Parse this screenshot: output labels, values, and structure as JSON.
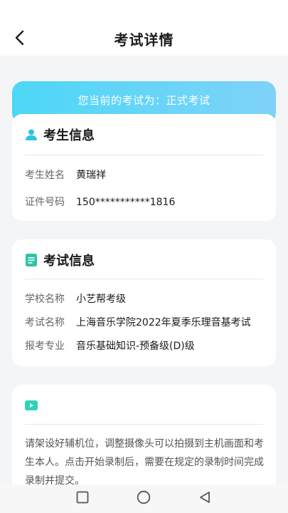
{
  "header": {
    "title": "考试详情",
    "back_icon": "chevron-left-icon"
  },
  "banner": {
    "text": "您当前的考试为：正式考试"
  },
  "candidate": {
    "title": "考生信息",
    "icon": "user-icon",
    "icon_color": "#2fc3e2",
    "rows": [
      {
        "label": "考生姓名",
        "value": "黄瑞祥"
      },
      {
        "label": "证件号码",
        "value": "150***********1816"
      }
    ]
  },
  "exam": {
    "title": "考试信息",
    "icon": "document-icon",
    "icon_color": "#2fc3a6",
    "rows": [
      {
        "label": "学校名称",
        "value": "小艺帮考级"
      },
      {
        "label": "考试名称",
        "value": "上海音乐学院2022年夏季乐理音基考试"
      },
      {
        "label": "报考专业",
        "value": "音乐基础知识-预备级(D)级"
      }
    ]
  },
  "notice": {
    "icon": "video-camera-icon",
    "icon_color": "#2fd3b8",
    "text": "请架设好辅机位，调整摄像头可以拍摄到主机画面和考生本人。点击开始录制后，需要在规定的录制时间完成录制并提交。"
  },
  "nav": {
    "recent_icon": "square-icon",
    "home_icon": "circle-icon",
    "back_icon": "triangle-back-icon"
  },
  "colors": {
    "banner_start": "#4dd7f6",
    "banner_end": "#7fd2f9",
    "background": "#f4f5f7"
  }
}
